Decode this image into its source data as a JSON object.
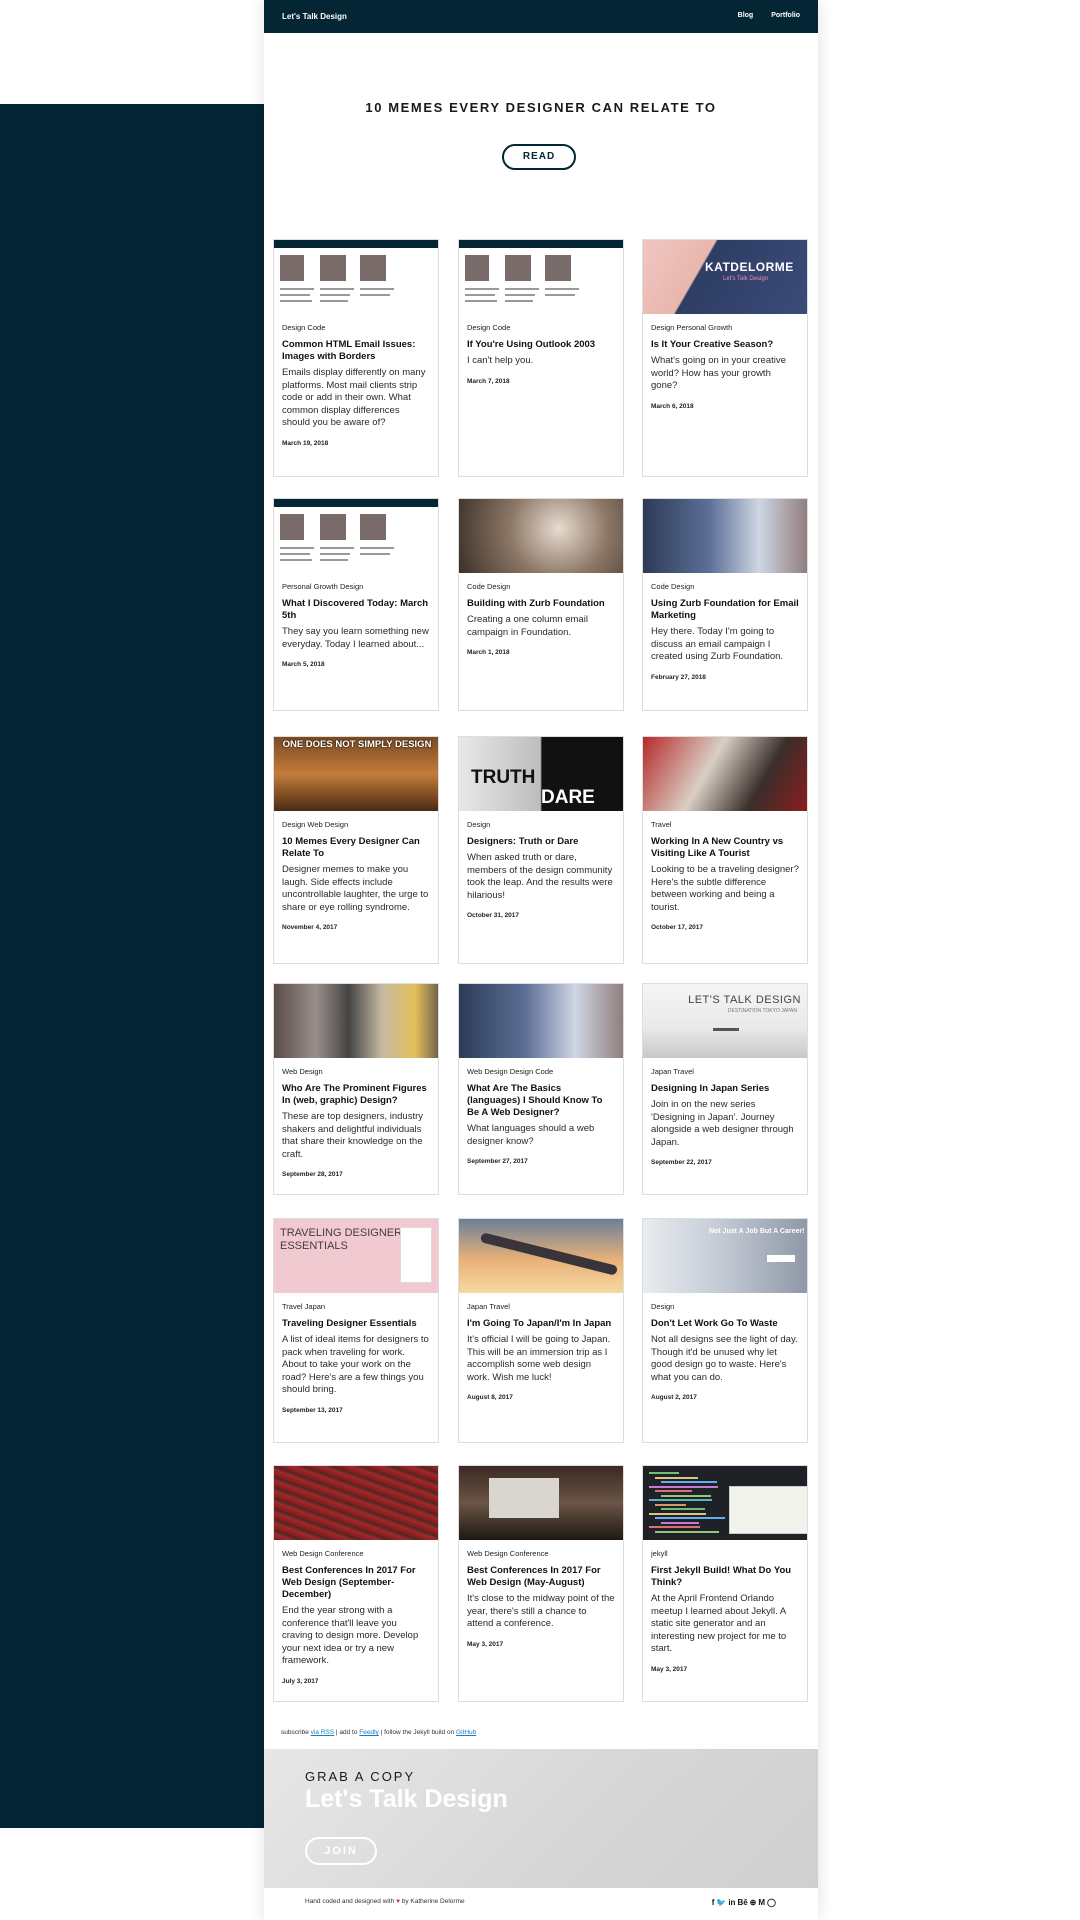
{
  "nav": {
    "brand": "Let's Talk Design",
    "links": [
      "Blog",
      "Portfolio"
    ]
  },
  "hero": {
    "title": "10 MEMES EVERY DESIGNER CAN RELATE TO",
    "button": "READ"
  },
  "posts": [
    {
      "thumb": "screens",
      "category": "Design Code",
      "title": "Common HTML Email Issues: Images with Borders",
      "excerpt": "Emails display differently on many platforms. Most mail clients strip code or add in their own. What common display differences should you be aware of?",
      "date": "March 19, 2018"
    },
    {
      "thumb": "screens",
      "category": "Design Code",
      "title": "If You're Using Outlook 2003",
      "excerpt": "I can't help you.",
      "date": "March 7, 2018"
    },
    {
      "thumb": "purple",
      "thumb_text": "KATDELORME",
      "thumb_sub": "Let's Talk Design",
      "category": "Design Personal Growth",
      "title": "Is It Your Creative Season?",
      "excerpt": "What's going on in your creative world? How has your growth gone?",
      "date": "March 6, 2018"
    },
    {
      "thumb": "screens",
      "category": "Personal Growth Design",
      "title": "What I Discovered Today: March 5th",
      "excerpt": "They say you learn something new everyday. Today I learned about...",
      "date": "March 5, 2018"
    },
    {
      "thumb": "desk",
      "category": "Code Design",
      "title": "Building with Zurb Foundation",
      "excerpt": "Creating a one column email campaign in Foundation.",
      "date": "March 1, 2018"
    },
    {
      "thumb": "office",
      "category": "Code Design",
      "title": "Using Zurb Foundation for Email Marketing",
      "excerpt": "Hey there. Today I'm going to discuss an email campaign I created using Zurb Foundation.",
      "date": "February 27, 2018"
    },
    {
      "thumb": "meme",
      "thumb_text": "ONE DOES NOT SIMPLY DESIGN",
      "category": "Design Web Design",
      "title": "10 Memes Every Designer Can Relate To",
      "excerpt": "Designer memes to make you laugh. Side effects include uncontrollable laughter, the urge to share or eye rolling syndrome.",
      "date": "November 4, 2017"
    },
    {
      "thumb": "truth",
      "thumb_text": "TRUTH",
      "thumb_sub": "DARE",
      "category": "Design",
      "title": "Designers: Truth or Dare",
      "excerpt": "When asked truth or dare, members of the design community took the leap. And the results were hilarious!",
      "date": "October 31, 2017"
    },
    {
      "thumb": "travel",
      "category": "Travel",
      "title": "Working In A New Country vs Visiting Like A Tourist",
      "excerpt": "Looking to be a traveling designer? Here's the subtle difference between working and being a tourist.",
      "date": "October 17, 2017"
    },
    {
      "thumb": "people",
      "category": "Web Design",
      "title": "Who Are The Prominent Figures In (web, graphic) Design?",
      "excerpt": "These are top designers, industry shakers and delightful individuals that share their knowledge on the craft.",
      "date": "September 28, 2017"
    },
    {
      "thumb": "office",
      "category": "Web Design Design Code",
      "title": "What Are The Basics (languages) I Should Know To Be A Web Designer?",
      "excerpt": "What languages should a web designer know?",
      "date": "September 27, 2017"
    },
    {
      "thumb": "japan",
      "thumb_text": "LET'S TALK DESIGN",
      "thumb_sub": "DESTINATION TOKYO JAPAN",
      "category": "Japan Travel",
      "title": "Designing In Japan Series",
      "excerpt": "Join in on the new series 'Designing in Japan'. Journey alongside a web designer through Japan.",
      "date": "September 22, 2017"
    },
    {
      "thumb": "pink",
      "thumb_text": "TRAVELING DESIGNER ESSENTIALS",
      "category": "Travel Japan",
      "title": "Traveling Designer Essentials",
      "excerpt": "A list of ideal items for designers to pack when traveling for work. About to take your work on the road? Here's are a few things you should bring.",
      "date": "September 13, 2017"
    },
    {
      "thumb": "wing",
      "category": "Japan Travel",
      "title": "I'm Going To Japan/I'm In Japan",
      "excerpt": "It's official I will be going to Japan. This will be an immersion trip as I accomplish some web design work. Wish me luck!",
      "date": "August 8, 2017"
    },
    {
      "thumb": "job",
      "thumb_text": "Not Just A Job But A Career!",
      "category": "Design",
      "title": "Don't Let Work Go To Waste",
      "excerpt": "Not all designs see the light of day. Though it'd be unused why let good design go to waste. Here's what you can do.",
      "date": "August 2, 2017"
    },
    {
      "thumb": "conf1",
      "category": "Web Design Conference",
      "title": "Best Conferences In 2017 For Web Design (September-December)",
      "excerpt": "End the year strong with a conference that'll leave you craving to design more. Develop your next idea or try a new framework.",
      "date": "July 3, 2017"
    },
    {
      "thumb": "conf2",
      "category": "Web Design Conference",
      "title": "Best Conferences In 2017 For Web Design (May-August)",
      "excerpt": "It's close to the midway point of the year, there's still a chance to attend a conference.",
      "date": "May 3, 2017"
    },
    {
      "thumb": "code",
      "category": "jekyll",
      "title": "First Jekyll Build! What Do You Think?",
      "excerpt": "At the April Frontend Orlando meetup I learned about Jekyll. A static site generator and an interesting new project for me to start.",
      "date": "May 3, 2017"
    }
  ],
  "subscribe": {
    "prefix": "subscribe ",
    "rss": "via RSS",
    "mid1": " | add to ",
    "feedly": "Feedly",
    "mid2": " | follow the Jekyll build on ",
    "github": "GitHub"
  },
  "banner": {
    "kicker": "GRAB A COPY",
    "title": "Let's Talk Design",
    "button": "JOIN"
  },
  "footer": {
    "text_before": "Hand coded and designed with ",
    "heart": "♥",
    "text_after": " by Katherine Delorme",
    "social": [
      "f",
      "🐦",
      "in",
      "Bē",
      "⊕",
      "M",
      "◯"
    ]
  },
  "colors": {
    "navy": "#042534",
    "link": "#1a7bbf"
  }
}
